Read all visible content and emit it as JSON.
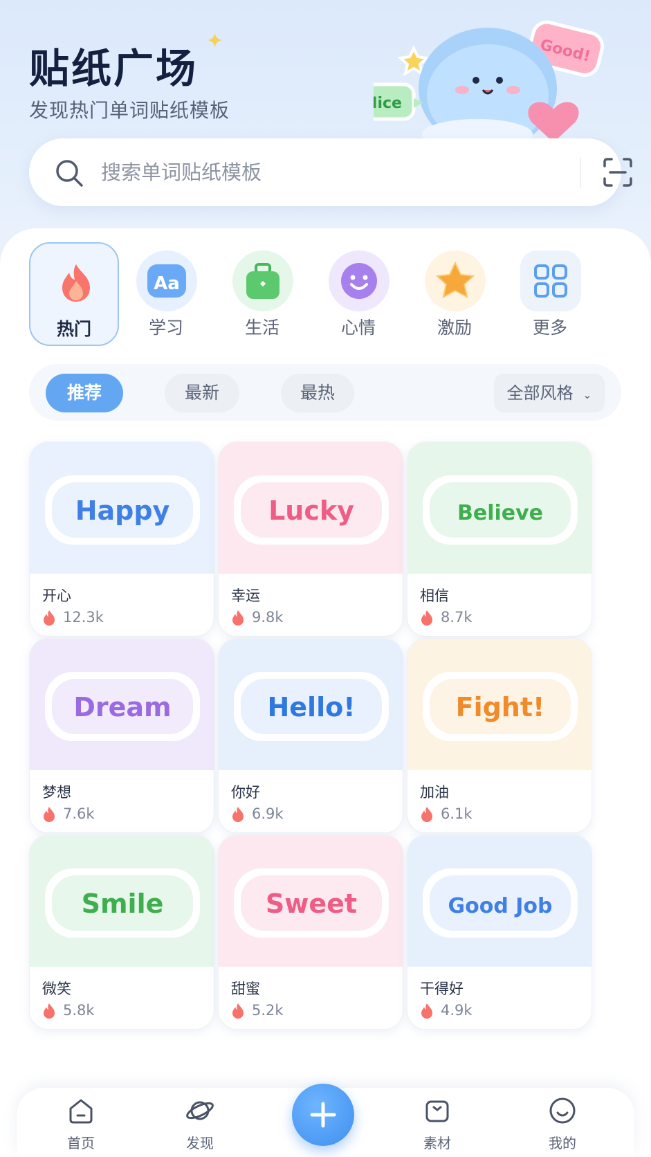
{
  "header": {
    "title": "贴纸广场",
    "subtitle": "发现热门单词贴纸模板",
    "mascot_badges": [
      "Nice",
      "Good!"
    ]
  },
  "search": {
    "placeholder": "搜索单词贴纸模板"
  },
  "categories": [
    {
      "label": "热门",
      "icon": "fire-icon",
      "active": true
    },
    {
      "label": "学习",
      "icon": "font-aa-icon"
    },
    {
      "label": "生活",
      "icon": "suitcase-icon"
    },
    {
      "label": "心情",
      "icon": "smiley-icon"
    },
    {
      "label": "激励",
      "icon": "star-icon"
    },
    {
      "label": "更多",
      "icon": "grid-icon"
    }
  ],
  "filters": {
    "tabs": [
      "推荐",
      "最新",
      "最热"
    ],
    "active": "推荐",
    "style_select": "全部风格"
  },
  "stickers": [
    {
      "word": "Happy",
      "name": "开心",
      "count": "12.3k",
      "color": "#3f7fe6"
    },
    {
      "word": "Lucky",
      "name": "幸运",
      "count": "9.8k",
      "color": "#ee5d86"
    },
    {
      "word": "Believe",
      "name": "相信",
      "count": "8.7k",
      "color": "#3fae4e"
    },
    {
      "word": "Dream",
      "name": "梦想",
      "count": "7.6k",
      "color": "#9a6be0"
    },
    {
      "word": "Hello!",
      "name": "你好",
      "count": "6.9k",
      "color": "#2f78e0"
    },
    {
      "word": "Fight!",
      "name": "加油",
      "count": "6.1k",
      "color": "#f08a2a"
    },
    {
      "word": "Smile",
      "name": "微笑",
      "count": "5.8k",
      "color": "#3fae4e"
    },
    {
      "word": "Sweet",
      "name": "甜蜜",
      "count": "5.2k",
      "color": "#ee5d86"
    },
    {
      "word": "Good Job",
      "name": "干得好",
      "count": "4.9k",
      "color": "#3f7fe6"
    }
  ],
  "tabbar": [
    {
      "label": "首页",
      "icon": "home-icon"
    },
    {
      "label": "发现",
      "icon": "planet-icon"
    },
    {
      "label": "",
      "icon": "plus-icon"
    },
    {
      "label": "素材",
      "icon": "box-icon"
    },
    {
      "label": "我的",
      "icon": "user-smile-icon"
    }
  ]
}
